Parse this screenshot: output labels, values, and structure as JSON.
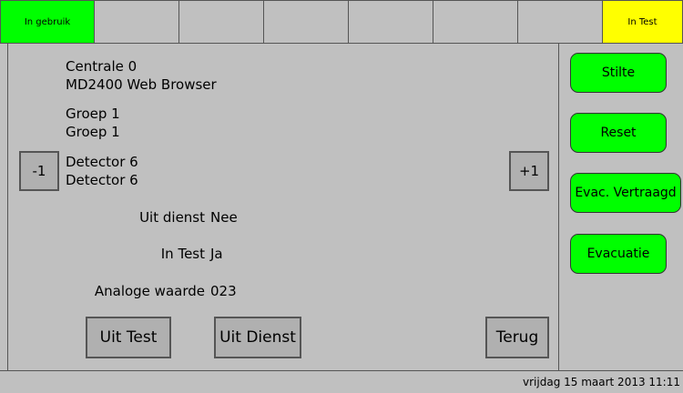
{
  "top_bar": {
    "cells": [
      {
        "label": "In gebruik",
        "color": "#00ff00"
      },
      {
        "label": ""
      },
      {
        "label": ""
      },
      {
        "label": ""
      },
      {
        "label": ""
      },
      {
        "label": ""
      },
      {
        "label": ""
      },
      {
        "label": "In Test",
        "color": "#ffff00"
      }
    ]
  },
  "info": {
    "centrale": "Centrale 0",
    "browser": "MD2400 Web Browser",
    "groep_1": "Groep 1",
    "groep_2": "Groep 1",
    "detector_1": "Detector 6",
    "detector_2": "Detector 6"
  },
  "nav": {
    "prev_label": "-1",
    "next_label": "+1"
  },
  "fields": {
    "uit_dienst_label": "Uit dienst",
    "uit_dienst_value": "Nee",
    "in_test_label": "In Test",
    "in_test_value": "Ja",
    "analoge_label": "Analoge waarde",
    "analoge_value": "023"
  },
  "actions": {
    "uit_test": "Uit Test",
    "uit_dienst": "Uit Dienst",
    "terug": "Terug"
  },
  "side_buttons": {
    "stilte": "Stilte",
    "reset": "Reset",
    "evac_vertraagd": "Evac. Vertraagd",
    "evacuatie": "Evacuatie",
    "color": "#00ff00"
  },
  "status": {
    "datetime": "vrijdag 15 maart 2013 11:11"
  }
}
